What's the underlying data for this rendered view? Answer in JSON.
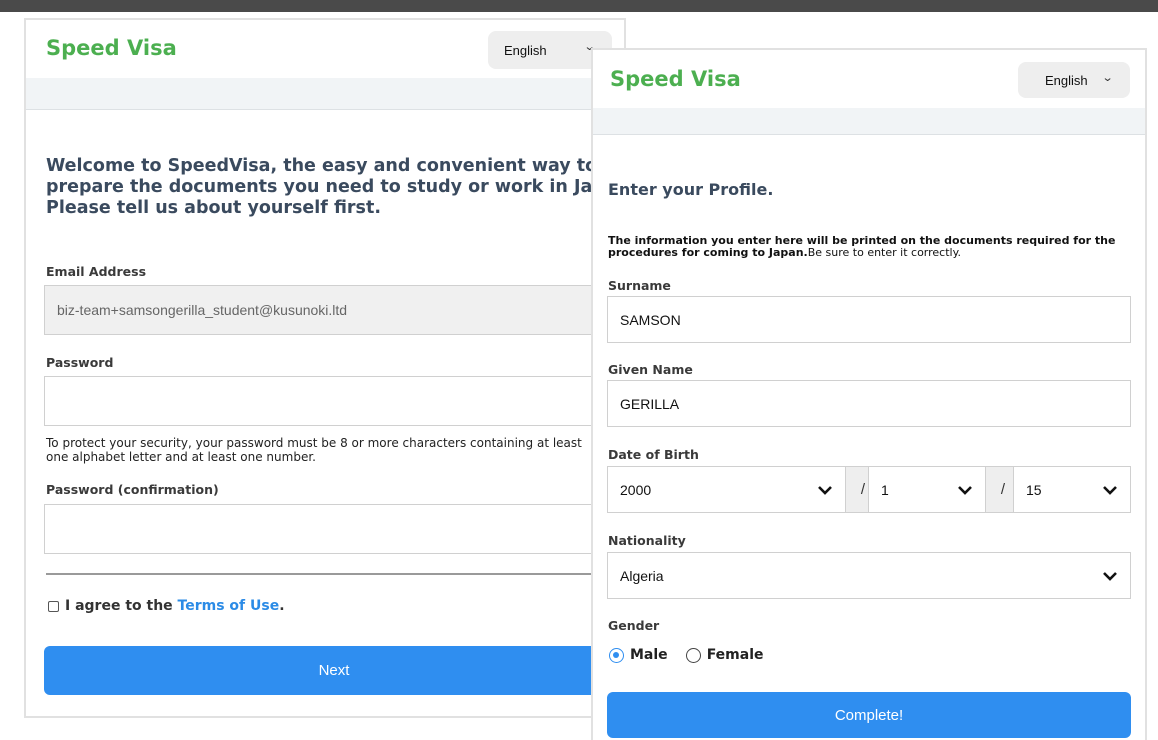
{
  "signup": {
    "brand": "Speed Visa",
    "language": "English",
    "intro": [
      "Welcome to SpeedVisa, the easy and convenient way to",
      "prepare the documents you need to study or work in Japan.",
      "Please tell us about yourself first."
    ],
    "email_label": "Email Address",
    "email_value": "biz-team+samsongerilla_student@kusunoki.ltd",
    "password_label": "Password",
    "password_help": [
      "To protect your security, your password must be 8 or more characters containing at least",
      "one alphabet letter and at least one number."
    ],
    "password_confirm_label": "Password (confirmation)",
    "agree_prefix": "I agree to the ",
    "terms_link": "Terms of Use",
    "agree_suffix": ".",
    "next_button": "Next"
  },
  "profile": {
    "brand": "Speed Visa",
    "language": "English",
    "title": "Enter your Profile.",
    "notice_bold": "The information you enter here will be printed on the documents required for the procedures for coming to Japan.",
    "notice_rest": "Be sure to enter it correctly.",
    "surname_label": "Surname",
    "surname_value": "SAMSON",
    "given_name_label": "Given Name",
    "given_name_value": "GERILLA",
    "dob_label": "Date of Birth",
    "dob_year": "2000",
    "dob_month": "1",
    "dob_day": "15",
    "dob_separator": "/",
    "nationality_label": "Nationality",
    "nationality_value": "Algeria",
    "gender_label": "Gender",
    "gender_male": "Male",
    "gender_female": "Female",
    "gender_selected": "Male",
    "complete_button": "Complete!"
  },
  "colors": {
    "brand": "#4caf50",
    "primary": "#2f8ef0",
    "heading": "#3a4a5e",
    "link": "#2b8be6"
  }
}
